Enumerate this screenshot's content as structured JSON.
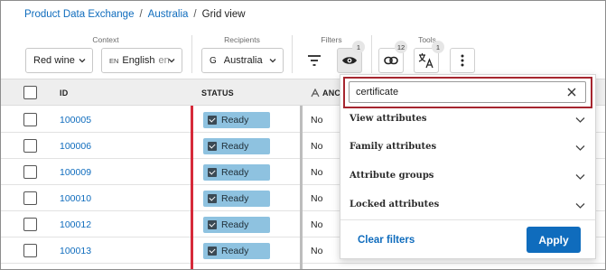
{
  "breadcrumb": {
    "items": [
      "Product Data Exchange",
      "Australia"
    ],
    "current": "Grid view"
  },
  "toolbar": {
    "groups": {
      "context": "Context",
      "recipients": "Recipients",
      "filters": "Filters",
      "tools": "Tools"
    },
    "context_select": "Red wine",
    "language_prefix": "EN",
    "language_select": "English",
    "language_suffix": "en",
    "recipient_prefix": "G",
    "recipient_select": "Australia",
    "filter_badge": "1",
    "link_badge": "12",
    "translate_badge": "1"
  },
  "grid": {
    "headers": {
      "id": "ID",
      "status": "STATUS",
      "anc": "ANC"
    },
    "rows": [
      {
        "id": "100005",
        "status": "Ready",
        "anc": "No"
      },
      {
        "id": "100006",
        "status": "Ready",
        "anc": "No"
      },
      {
        "id": "100009",
        "status": "Ready",
        "anc": "No"
      },
      {
        "id": "100010",
        "status": "Ready",
        "anc": "No"
      },
      {
        "id": "100012",
        "status": "Ready",
        "anc": "No"
      },
      {
        "id": "100013",
        "status": "Ready",
        "anc": "No"
      }
    ]
  },
  "filter_panel": {
    "search_value": "certificate",
    "sections": [
      "View attributes",
      "Family attributes",
      "Attribute groups",
      "Locked attributes"
    ],
    "clear_label": "Clear filters",
    "apply_label": "Apply"
  },
  "colors": {
    "accent": "#0f6cbd",
    "ready": "#8ec2e0",
    "highlight": "#a6262f",
    "status_bar": "#d62a3a"
  }
}
